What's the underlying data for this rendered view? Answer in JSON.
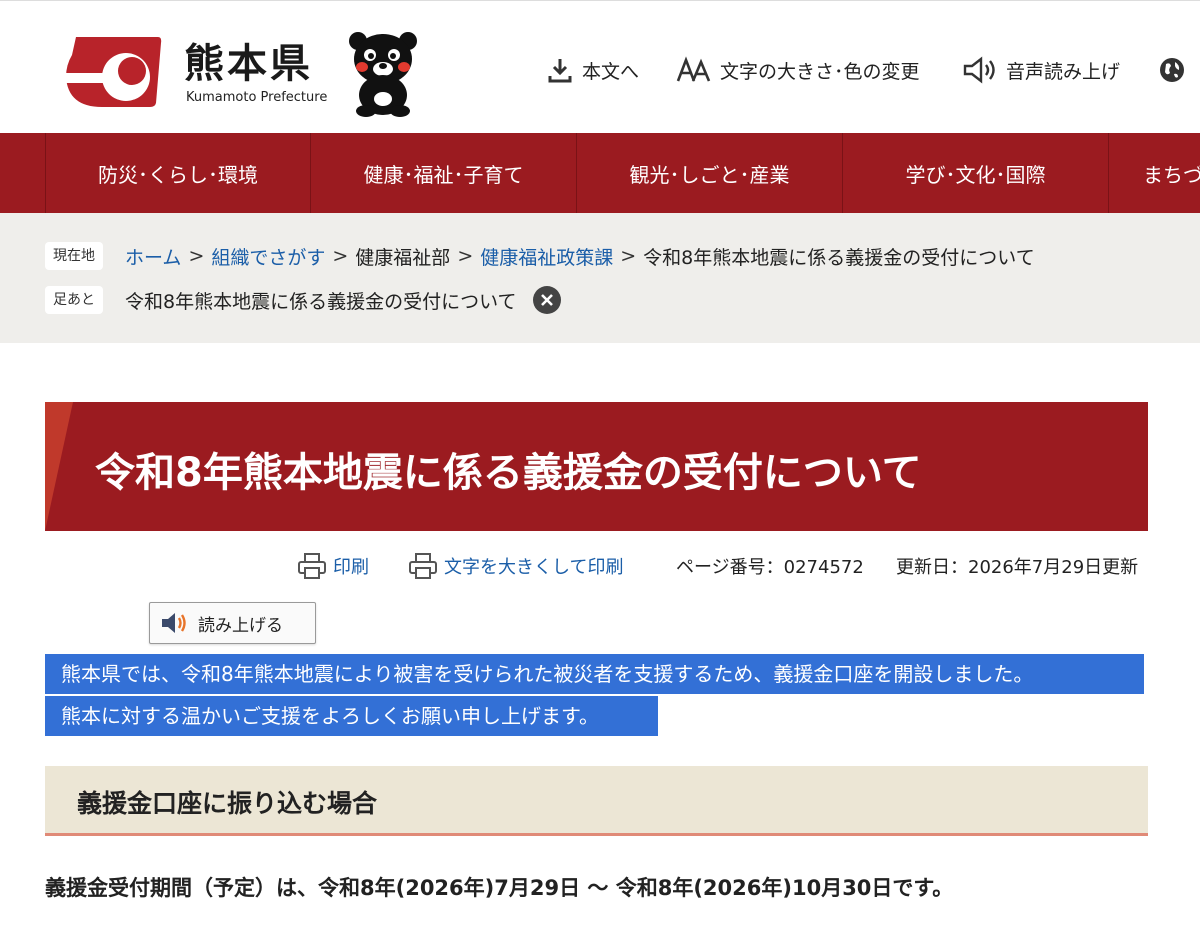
{
  "header": {
    "logo_jp": "熊本県",
    "logo_en": "Kumamoto Prefecture",
    "utilities": [
      {
        "label": "本文へ",
        "icon": "download-icon"
      },
      {
        "label": "文字の大きさ･色の変更",
        "icon": "text-size-icon"
      },
      {
        "label": "音声読み上げ",
        "icon": "speaker-icon"
      },
      {
        "label": "",
        "icon": "globe-icon"
      }
    ]
  },
  "gnav": {
    "items": [
      {
        "label": "防災･くらし･環境"
      },
      {
        "label": "健康･福祉･子育て"
      },
      {
        "label": "観光･しごと･産業"
      },
      {
        "label": "学び･文化･国際"
      },
      {
        "label": "まちづ"
      }
    ]
  },
  "breadcrumb": {
    "current_tag": "現在地",
    "home": "ホーム",
    "sep": ">",
    "org": "組織でさがす",
    "dept": "健康福祉部",
    "section": "健康福祉政策課",
    "current": "令和8年熊本地震に係る義援金の受付について",
    "footprint_tag": "足あと",
    "footprint_item": "令和8年熊本地震に係る義援金の受付について"
  },
  "page": {
    "title": "令和8年熊本地震に係る義援金の受付について",
    "print_label": "印刷",
    "large_print_label": "文字を大きくして印刷",
    "page_number": "ページ番号：0274572",
    "updated": "更新日：2026年7月29日更新",
    "read_aloud_label": "読み上げる",
    "intro_line1": "熊本県では、令和8年熊本地震により被害を受けられた被災者を支援するため、義援金口座を開設しました。",
    "intro_line2": "熊本に対する温かいご支援をよろしくお願い申し上げます。",
    "section_heading": "義援金口座に振り込む場合",
    "period_text": "義援金受付期間（予定）は、令和8年(2026年)7月29日 ～ 令和8年(2026年)10月30日です。"
  },
  "colors": {
    "brand_red": "#9b1b20",
    "link_blue": "#1b5ea8",
    "selection_blue": "#3370d6",
    "section_bg": "#ece6d5",
    "section_border": "#e08a77"
  }
}
